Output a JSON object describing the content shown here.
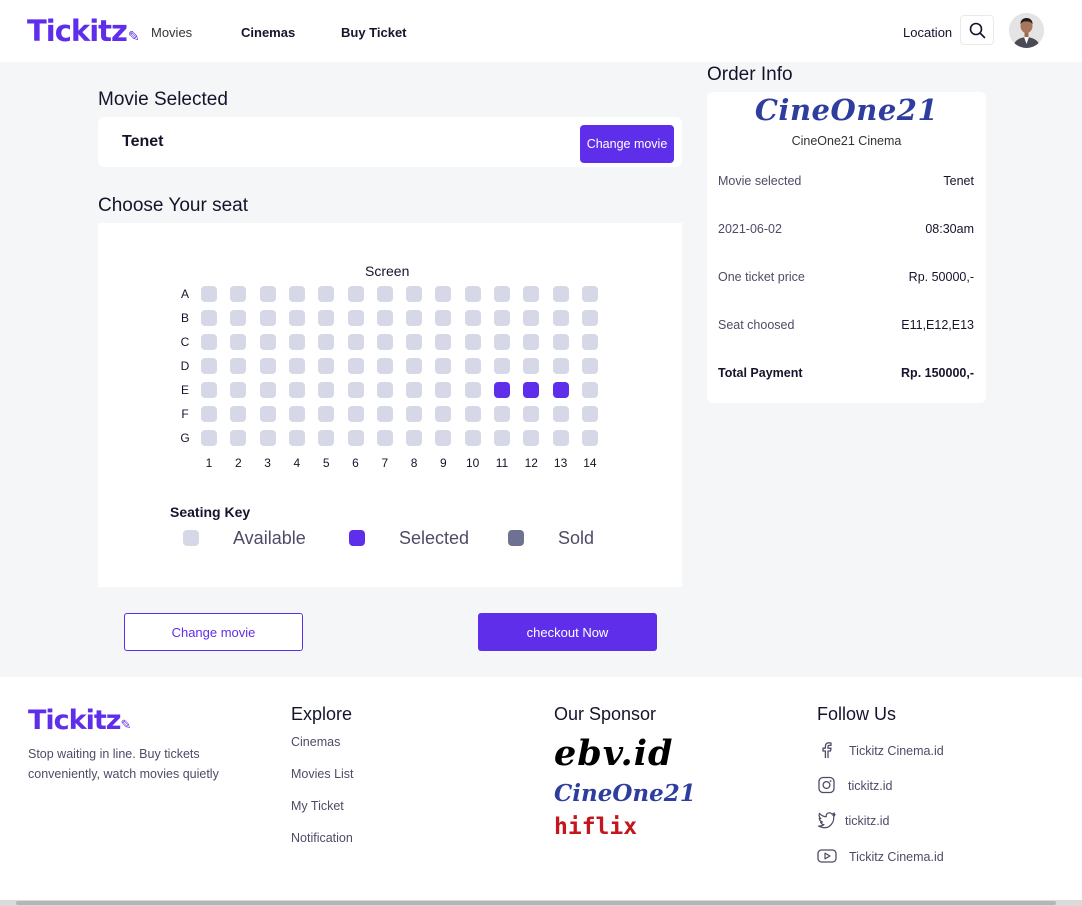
{
  "header": {
    "logo": "Tickitz",
    "nav": [
      "Movies",
      "Cinemas",
      "Buy Ticket"
    ],
    "location": "Location"
  },
  "movie_selected": {
    "title": "Movie Selected",
    "movie": "Tenet",
    "change_label": "Change movie"
  },
  "seat": {
    "title": "Choose Your seat",
    "screen": "Screen",
    "rows": [
      "A",
      "B",
      "C",
      "D",
      "E",
      "F",
      "G"
    ],
    "columns": [
      "1",
      "2",
      "3",
      "4",
      "5",
      "6",
      "7",
      "8",
      "9",
      "10",
      "11",
      "12",
      "13",
      "14"
    ],
    "selected": [
      "E11",
      "E12",
      "E13"
    ],
    "key_title": "Seating Key",
    "key": [
      {
        "label": "Available",
        "color": "#d6d8e7"
      },
      {
        "label": "Selected",
        "color": "#5f2eea"
      },
      {
        "label": "Sold",
        "color": "#6e7191"
      }
    ]
  },
  "actions": {
    "change_movie": "Change movie",
    "checkout": "checkout Now"
  },
  "order_info": {
    "title": "Order Info",
    "cinema_logo": "CineOne21",
    "cinema_name": "CineOne21 Cinema",
    "rows": [
      {
        "key": "Movie selected",
        "value": "Tenet"
      },
      {
        "key": "2021-06-02",
        "value": "08:30am"
      },
      {
        "key": "One ticket price",
        "value": "Rp. 50000,-"
      },
      {
        "key": "Seat choosed",
        "value": "E11,E12,E13"
      },
      {
        "key": "Total Payment",
        "value": "Rp. 150000,-"
      }
    ]
  },
  "footer": {
    "logo": "Tickitz",
    "tagline": "Stop waiting in line. Buy tickets conveniently, watch movies quietly",
    "explore_title": "Explore",
    "explore": [
      "Cinemas",
      "Movies List",
      "My Ticket",
      "Notification"
    ],
    "sponsor_title": "Our Sponsor",
    "sponsors": [
      "ebv.id",
      "CineOne21",
      "hiflix"
    ],
    "follow_title": "Follow Us",
    "social": [
      {
        "icon": "facebook-icon",
        "label": "Tickitz Cinema.id"
      },
      {
        "icon": "instagram-icon",
        "label": "tickitz.id"
      },
      {
        "icon": "twitter-icon",
        "label": "tickitz.id"
      },
      {
        "icon": "youtube-icon",
        "label": "Tickitz Cinema.id"
      }
    ]
  },
  "colors": {
    "primary": "#5f2eea",
    "background": "#f5f6f8"
  }
}
